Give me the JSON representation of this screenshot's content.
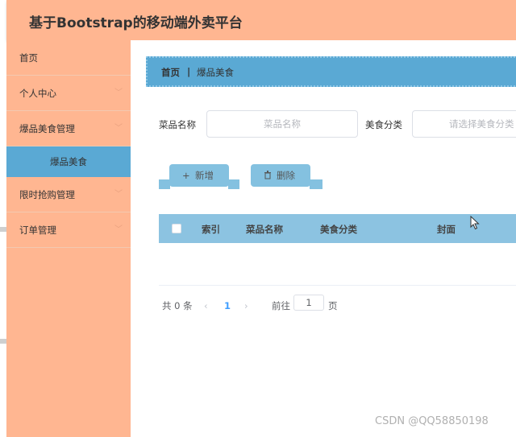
{
  "app": {
    "title": "基于Bootstrap的移动端外卖平台"
  },
  "sidebar": {
    "items": [
      {
        "label": "首页",
        "has_chevron": false
      },
      {
        "label": "个人中心",
        "has_chevron": true
      },
      {
        "label": "爆品美食管理",
        "has_chevron": true
      },
      {
        "label": "爆品美食",
        "sub": true,
        "active": true
      },
      {
        "label": "限时抢购管理",
        "has_chevron": true
      },
      {
        "label": "订单管理",
        "has_chevron": true
      }
    ],
    "chevron_icon": "chevron-down-icon"
  },
  "breadcrumb": {
    "home": "首页",
    "separator": "|",
    "current": "爆品美食"
  },
  "search": {
    "name_label": "菜品名称",
    "name_placeholder": "菜品名称",
    "category_label": "美食分类",
    "category_placeholder": "请选择美食分类"
  },
  "toolbar": {
    "add_label": "新增",
    "add_icon": "plus-icon",
    "delete_label": "删除",
    "delete_icon": "trash-icon"
  },
  "table": {
    "columns": [
      "索引",
      "菜品名称",
      "美食分类",
      "封面"
    ],
    "rows": []
  },
  "pagination": {
    "total": "共 0 条",
    "prev": "‹",
    "current_page": "1",
    "next": "›",
    "goto_prefix": "前往",
    "goto_value": "1",
    "goto_suffix": "页"
  },
  "watermark": "CSDN @QQ58850198",
  "colors": {
    "header_bg": "#ffb691",
    "sidebar_bg": "#ffb691",
    "active_item_bg": "#5aa9d4",
    "breadcrumb_bg": "#5aa9d4",
    "button_bg": "#84c1e0",
    "table_head_bg": "#8cc3e1"
  }
}
